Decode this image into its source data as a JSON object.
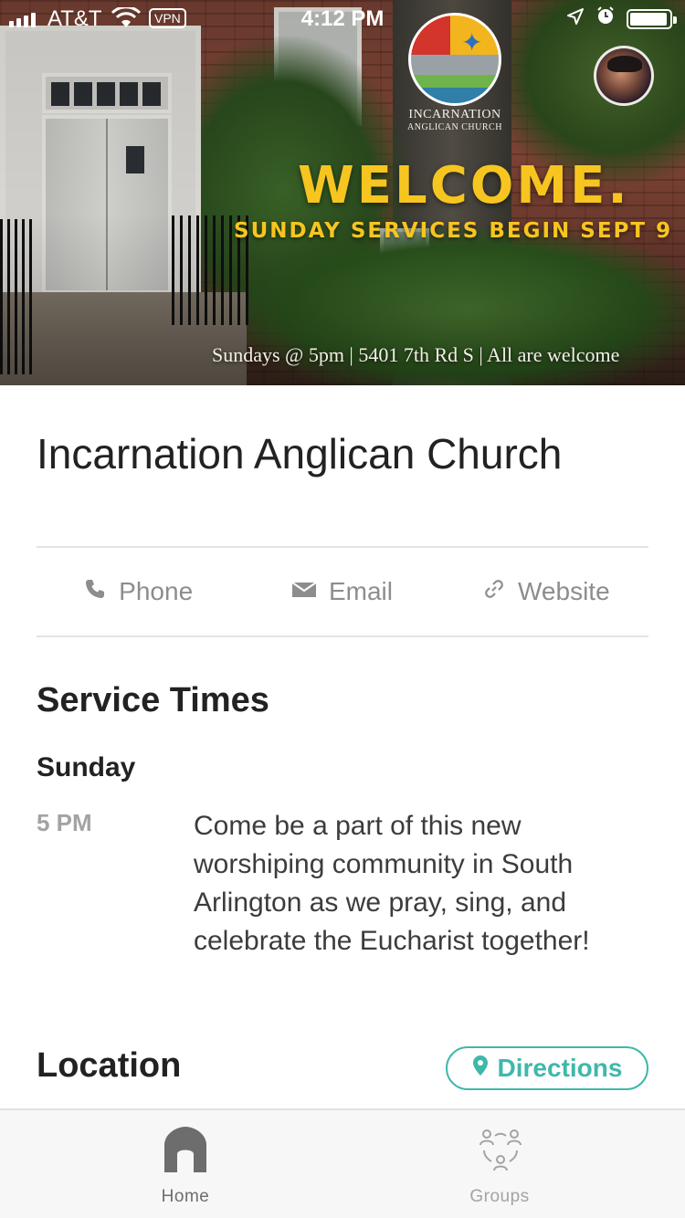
{
  "status_bar": {
    "carrier": "AT&T",
    "vpn": "VPN",
    "time": "4:12 PM",
    "battery_level": 0.95,
    "icons": [
      "signal-icon",
      "wifi-icon",
      "location-arrow-icon",
      "alarm-icon",
      "battery-icon"
    ]
  },
  "hero": {
    "logo_name": "INCARNATION",
    "logo_sub": "ANGLICAN CHURCH",
    "headline": "WELCOME.",
    "subheadline": "SUNDAY SERVICES BEGIN SEPT 9",
    "banner": "Sundays @ 5pm  |  5401 7th Rd S  |  All are welcome"
  },
  "church": {
    "name": "Incarnation Anglican Church"
  },
  "contact": {
    "phone_label": "Phone",
    "email_label": "Email",
    "website_label": "Website",
    "icons": [
      "phone-icon",
      "email-icon",
      "link-icon"
    ]
  },
  "service_times": {
    "title": "Service Times",
    "day": "Sunday",
    "time": "5 PM",
    "description": "Come be a part of this new worshiping community in South Arlington as we pray, sing, and celebrate the Eucharist together!"
  },
  "location": {
    "title": "Location",
    "directions_label": "Directions"
  },
  "tabs": [
    {
      "label": "Home",
      "icon": "home-icon",
      "active": true
    },
    {
      "label": "Groups",
      "icon": "groups-icon",
      "active": false
    }
  ],
  "colors": {
    "accent": "#3fb8aa",
    "welcome_yellow": "#f7c520",
    "tab_active": "#6d6d6d",
    "tab_inactive": "#a3a3a3",
    "muted_text": "#8d8d8d"
  }
}
